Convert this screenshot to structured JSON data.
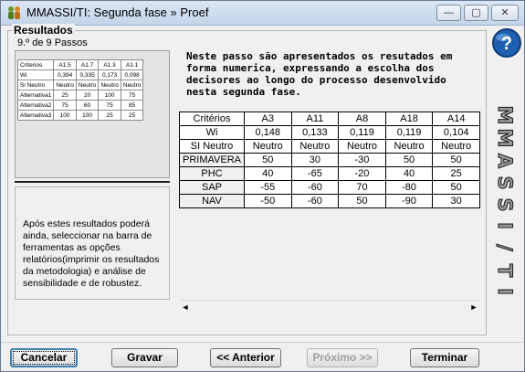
{
  "window": {
    "title": "MMASSI/TI: Segunda fase  »  Proef",
    "minimize": "—",
    "maximize": "▢",
    "close": "✕"
  },
  "group": {
    "legend": "Resultados",
    "step": "9.º de 9 Passos"
  },
  "preview_table": {
    "headers": [
      "Criterios",
      "A1.5",
      "A1.7",
      "A1.3",
      "A1.1"
    ],
    "rows": [
      [
        "Wi",
        "0,394",
        "0,335",
        "0,173",
        "0,098"
      ],
      [
        "Si Neutro",
        "Neutro",
        "Neutro",
        "Neutro",
        "Neutro"
      ],
      [
        "Alternativa1",
        "25",
        "20",
        "100",
        "75"
      ],
      [
        "Alternativa2",
        "75",
        "60",
        "75",
        "85"
      ],
      [
        "Alternativa3",
        "100",
        "100",
        "25",
        "25"
      ]
    ]
  },
  "info_text": "Após estes resultados poderá ainda, seleccionar na barra de ferramentas as opções relatórios(imprimir os resultados da metodologia) e análise de sensibilidade e de robustez.",
  "intro_text": "Neste passo são apresentados os resutados em forma numerica, expressando a escolha dos decisores ao longo do processo desenvolvido nesta segunda fase.",
  "results_table": {
    "headers": [
      "Critérios",
      "A3",
      "A11",
      "A8",
      "A18",
      "A14"
    ],
    "wi": [
      "Wi",
      "0,148",
      "0,133",
      "0,119",
      "0,119",
      "0,104"
    ],
    "si": [
      "SI Neutro",
      "Neutro",
      "Neutro",
      "Neutro",
      "Neutro",
      "Neutro"
    ],
    "rows": [
      [
        "PRIMAVERA",
        "50",
        "30",
        "-30",
        "50",
        "50"
      ],
      [
        "PHC",
        "40",
        "-65",
        "-20",
        "40",
        "25"
      ],
      [
        "SAP",
        "-55",
        "-60",
        "70",
        "-80",
        "50"
      ],
      [
        "NAV",
        "-50",
        "-60",
        "50",
        "-90",
        "30"
      ]
    ]
  },
  "scroll": {
    "left": "◄",
    "right": "►"
  },
  "buttons": {
    "cancel": "Cancelar",
    "save": "Gravar",
    "previous": "<< Anterior",
    "next": "Próximo >>",
    "finish": "Terminar"
  },
  "brand_letters": [
    "M",
    "M",
    "A",
    "S",
    "S",
    "I",
    "/",
    "T",
    "I"
  ],
  "colors": {
    "accent": "#3c7fb1",
    "disabled_text": "#a0a0a0"
  }
}
